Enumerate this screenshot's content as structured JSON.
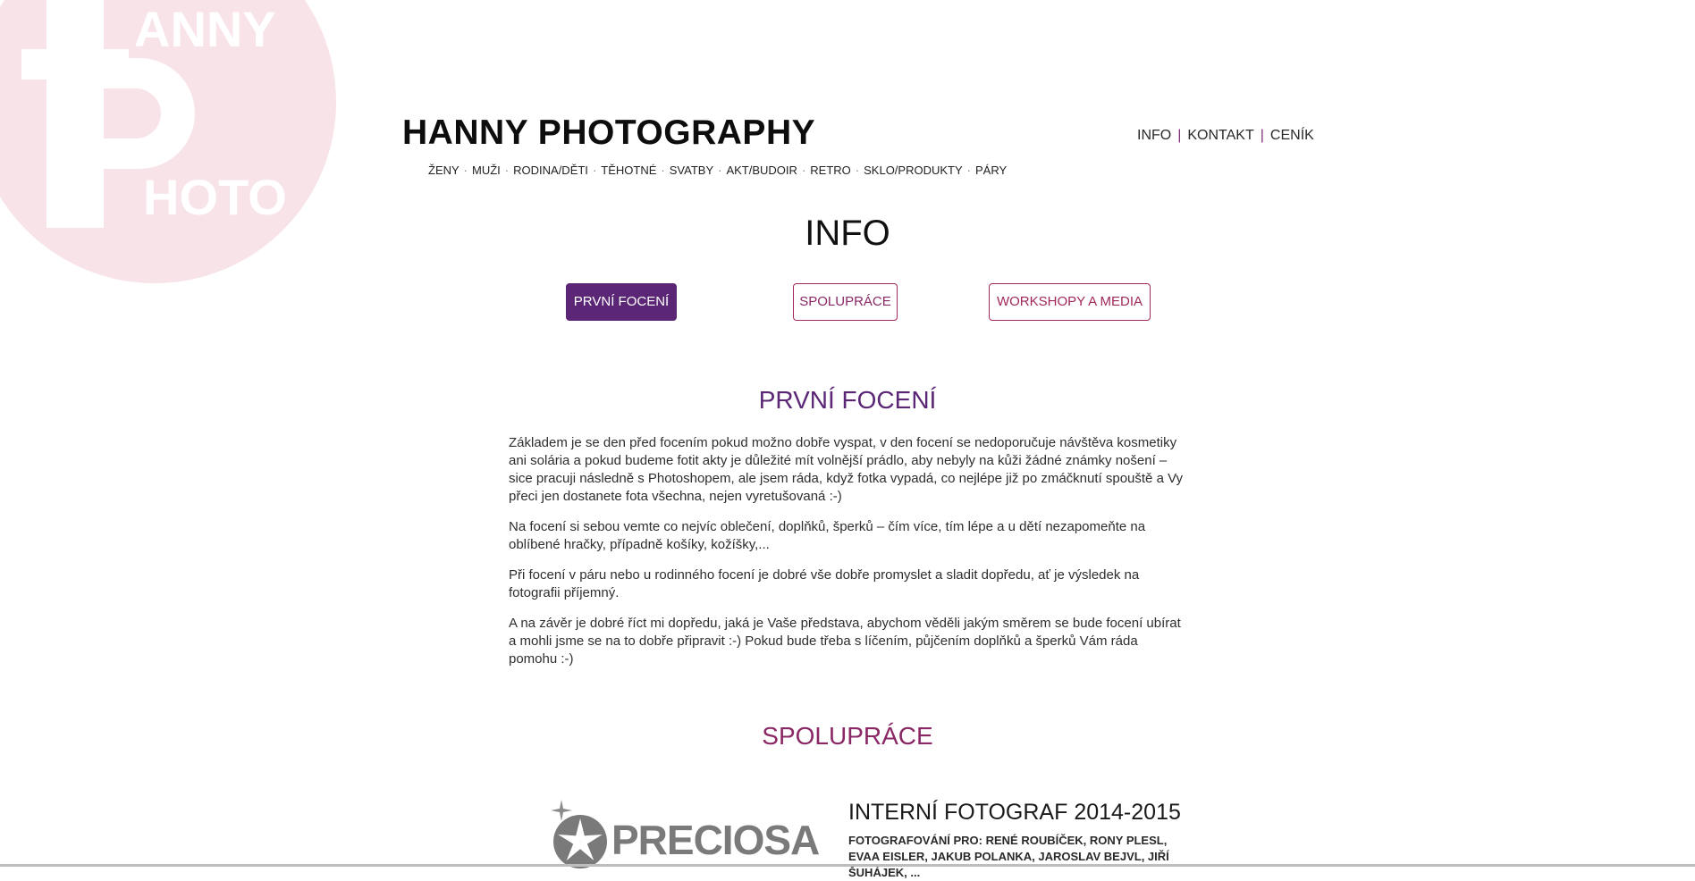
{
  "logo": {
    "top_text": "ANNY",
    "bottom_text": "HOTO",
    "color": "#f8e4e8"
  },
  "site": {
    "title": "HANNY PHOTOGRAPHY"
  },
  "categories": [
    "ŽENY",
    "MUŽI",
    "RODINA/DĚTI",
    "TĚHOTNÉ",
    "SVATBY",
    "AKT/BUDOIR",
    "RETRO",
    "SKLO/PRODUKTY",
    "PÁRY"
  ],
  "category_separator": "·",
  "top_nav": {
    "items": [
      "INFO",
      "KONTAKT",
      "CENÍK"
    ],
    "separator": "|"
  },
  "page": {
    "heading": "INFO"
  },
  "tabs": [
    {
      "label": "PRVNÍ FOCENÍ",
      "active": true
    },
    {
      "label": "SPOLUPRÁCE",
      "active": false
    },
    {
      "label": "WORKSHOPY A MEDIA",
      "active": false
    }
  ],
  "first_shoot": {
    "heading": "PRVNÍ FOCENÍ",
    "paragraphs": [
      "Základem je se den před focením pokud možno dobře vyspat, v den focení se nedoporučuje návštěva kosmetiky ani solária a pokud budeme fotit akty je důležité mít volnější prádlo, aby nebyly na kůži žádné známky nošení – sice pracuji následně s Photoshopem, ale jsem ráda, když fotka vypadá, co nejlépe již po zmáčknutí spouště a Vy přeci jen dostanete fota všechna, nejen vyretušovaná :-)",
      "Na focení si sebou vemte co nejvíc oblečení, doplňků, šperků – čím více, tím lépe a u dětí nezapomeňte na oblíbené hračky, případně košíky, kožíšky,...",
      "Při focení v páru nebo u rodinného focení je dobré vše dobře promyslet a sladit dopředu, ať je výsledek na fotografii příjemný.",
      "A na závěr je dobré říct mi dopředu, jaká je Vaše představa, abychom věděli jakým směrem se bude focení ubírat a mohli jsme se na to dobře připravit :-) Pokud bude třeba s líčením, půjčením doplňků a šperků Vám ráda pomohu :-)"
    ]
  },
  "cooperation": {
    "heading": "SPOLUPRÁCE",
    "logo_text": "PRECIOSA",
    "job_title": "INTERNÍ FOTOGRAF 2014-2015",
    "job_desc": "FOTOGRAFOVÁNÍ PRO: RENÉ ROUBÍČEK, RONY PLESL, EVAA EISLER, JAKUB POLANKA, JAROSLAV BEJVL, JIŘÍ ŠUHÁJEK, ..."
  },
  "colors": {
    "purple": "#5a2675",
    "magenta": "#8a2865",
    "button_border": "#a0285a"
  }
}
